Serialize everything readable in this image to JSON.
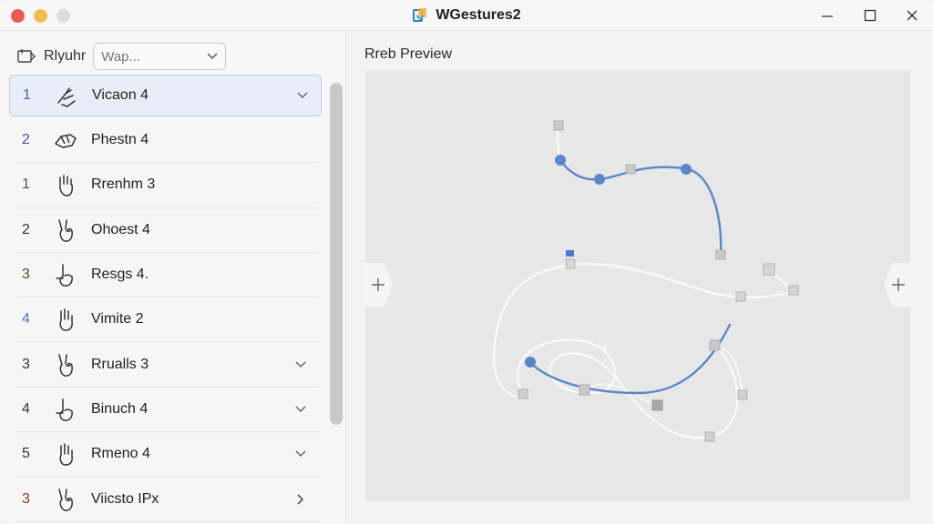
{
  "app": {
    "title": "WGestures2"
  },
  "colors": {
    "accent": "#5b86c9",
    "close": "#ee5b55",
    "minimize": "#f4be4f",
    "maximize": "#dcdcdc"
  },
  "filter": {
    "label": "Rlyuhr",
    "select_value": "Wap...",
    "icon": "filter-tag-icon"
  },
  "gestures": [
    {
      "num": "1",
      "num_color": "#3f63b5",
      "label": "Vicaon 4",
      "chevron": "down",
      "icon": "two-finger-swipe-icon"
    },
    {
      "num": "2",
      "num_color": "#4a4f9a",
      "label": "Phestn 4",
      "chevron": "",
      "icon": "pinch-hand-icon"
    },
    {
      "num": "1",
      "num_color": "#2d6e2d",
      "label": "Rrenhm 3",
      "chevron": "",
      "icon": "open-hand-icon"
    },
    {
      "num": "2",
      "num_color": "#333333",
      "label": "Ohoest 4",
      "chevron": "",
      "icon": "peace-hand-icon"
    },
    {
      "num": "3",
      "num_color": "#3a5a1f",
      "label": "Resgs 4.",
      "chevron": "",
      "icon": "point-hand-icon"
    },
    {
      "num": "4",
      "num_color": "#4a7ad0",
      "label": "Vimite 2",
      "chevron": "",
      "icon": "raised-hand-icon"
    },
    {
      "num": "3",
      "num_color": "#333333",
      "label": "Rrualls 3",
      "chevron": "down",
      "icon": "peace-hand-icon"
    },
    {
      "num": "4",
      "num_color": "#333333",
      "label": "Binuch 4",
      "chevron": "down",
      "icon": "point-hand-icon"
    },
    {
      "num": "5",
      "num_color": "#333333",
      "label": "Rmeno 4",
      "chevron": "down",
      "icon": "raised-hand-icon"
    },
    {
      "num": "3",
      "num_color": "#8a3a2a",
      "label": "Viicsto IPx",
      "chevron": "right",
      "icon": "peace-hand-icon"
    }
  ],
  "preview": {
    "title": "Rreb Preview",
    "nav_left_icon": "plus-icon",
    "nav_right_icon": "plus-icon"
  }
}
